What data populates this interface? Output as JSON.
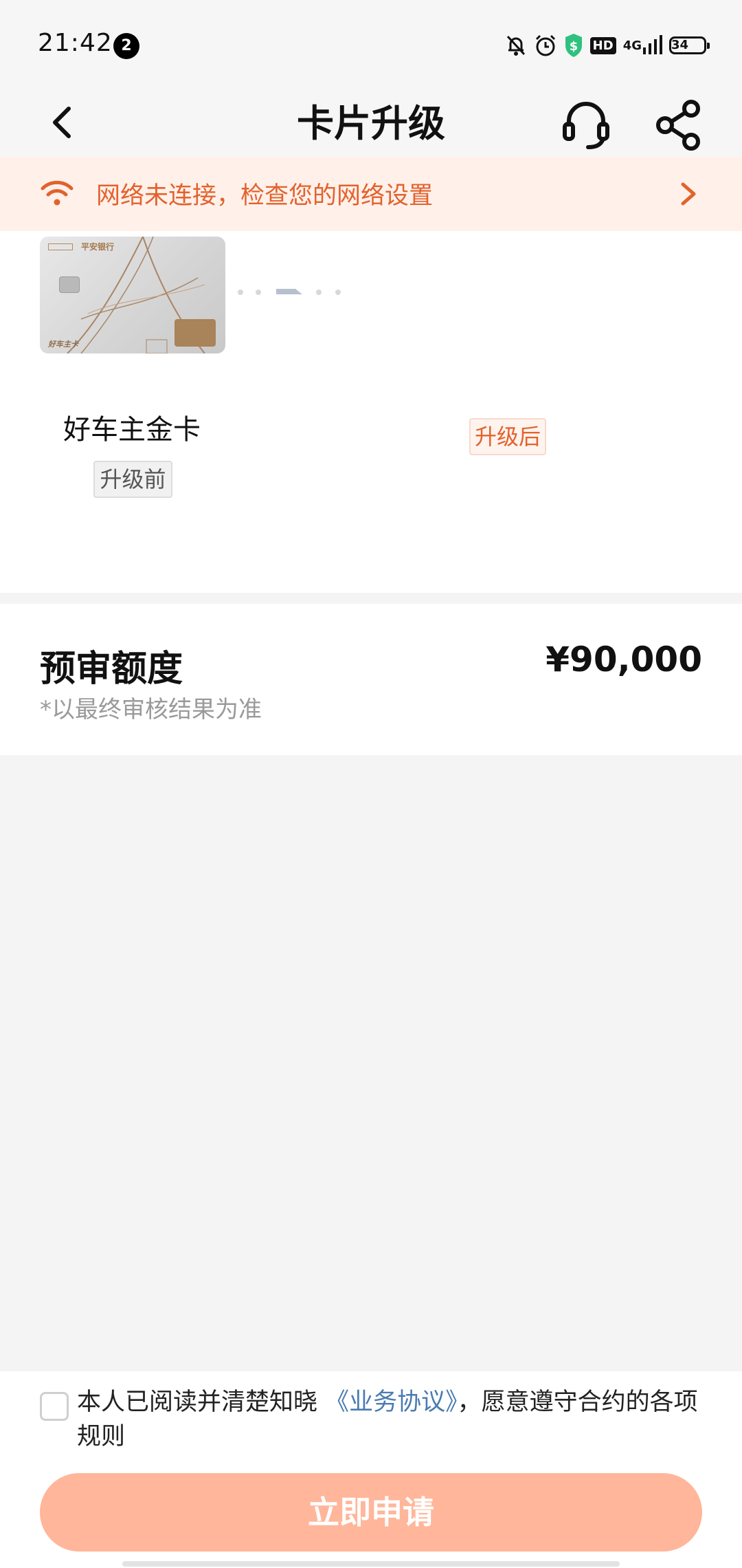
{
  "status_bar": {
    "time": "21:42",
    "notification_count": "2",
    "network": "4G",
    "hd": "HD",
    "battery": "34"
  },
  "nav": {
    "title": "卡片升级"
  },
  "network_banner": {
    "text": "网络未连接，检查您的网络设置",
    "color": "#e2622c"
  },
  "card": {
    "bank_name": "平安银行",
    "card_title": "好车主卡",
    "old_card_name": "好车主金卡",
    "before_label": "升级前",
    "after_label": "升级后"
  },
  "credit": {
    "label": "预审额度",
    "value": "¥90,000",
    "note": "*以最终审核结果为准"
  },
  "agreement": {
    "prefix": "本人已阅读并清楚知晓",
    "link": "《业务协议》",
    "suffix": "，愿意遵守合约的各项规则"
  },
  "apply_button": {
    "label": "立即申请",
    "color": "#ffb69a"
  },
  "icons": [
    "mute-bell-icon",
    "alarm-icon",
    "dollar-icon",
    "back-icon",
    "headset-icon",
    "share-icon",
    "wifi-icon",
    "chevron-right-icon"
  ]
}
